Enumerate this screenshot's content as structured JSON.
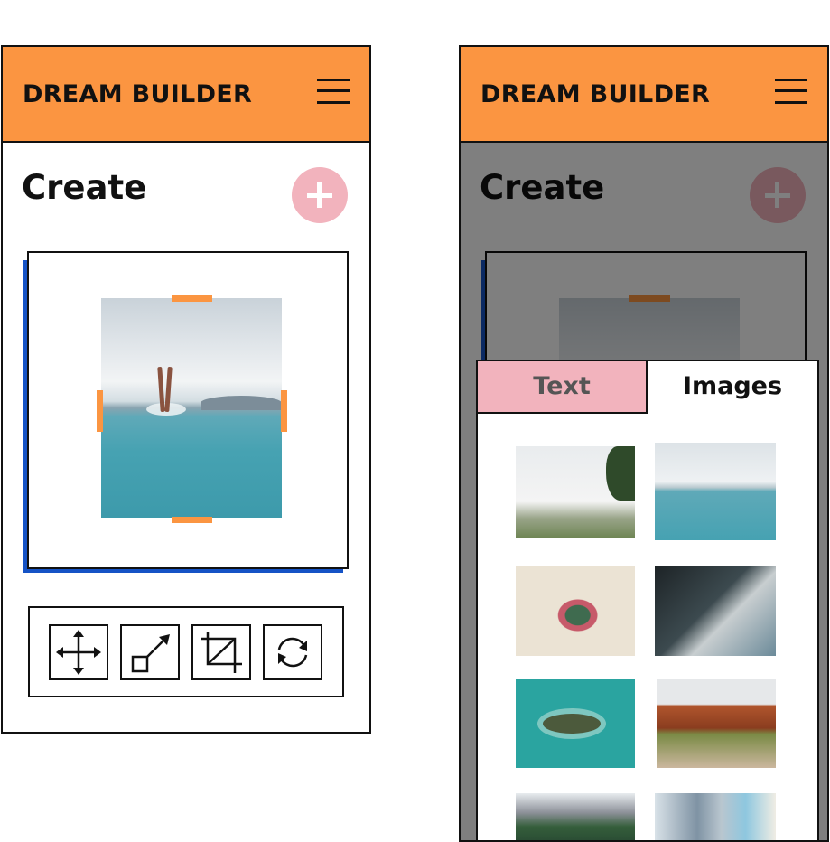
{
  "app": {
    "brand": "DREAM BUILDER",
    "page_title": "Create"
  },
  "colors": {
    "header": "#fb9541",
    "accent_pink": "#f2b3bd",
    "canvas_shadow": "#1553c6",
    "crop_handles": "#fb9541"
  },
  "left_screen": {
    "icons": [
      "menu-icon",
      "plus-icon"
    ],
    "canvas_image": "swimmer-legs-in-lake-photo",
    "tools": [
      {
        "name": "move-tool",
        "icon": "move-arrows-icon"
      },
      {
        "name": "resize-tool",
        "icon": "resize-diagonal-icon"
      },
      {
        "name": "crop-tool",
        "icon": "crop-icon"
      },
      {
        "name": "rotate-tool",
        "icon": "rotate-refresh-icon"
      }
    ]
  },
  "right_screen": {
    "overlay": "dimmed",
    "tabs": [
      {
        "label": "Text",
        "active": false
      },
      {
        "label": "Images",
        "active": true
      }
    ],
    "images": [
      "white-modern-house-photo",
      "swimmer-legs-in-lake-photo",
      "cactus-illustration-photo",
      "glass-building-photo",
      "small-island-aerial-photo",
      "autumn-tree-avenue-photo",
      "mountain-lake-photo",
      "coastal-city-skyline-photo"
    ]
  }
}
